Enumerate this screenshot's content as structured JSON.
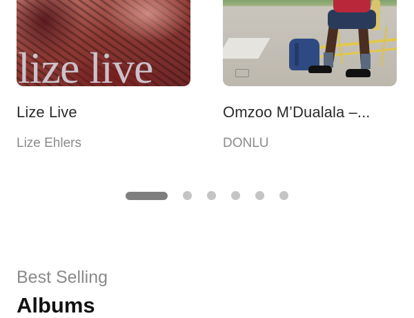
{
  "carousel": {
    "albums": [
      {
        "cover_text": "lize live",
        "title": "Lize Live",
        "artist": "Lize Ehlers"
      },
      {
        "cover_text": "",
        "title": "Omzoo M’Dualala –...",
        "artist": "DONLU"
      }
    ],
    "pager": {
      "count": 6,
      "active_index": 0
    }
  },
  "section": {
    "kicker": "Best Selling",
    "heading": "Albums"
  },
  "colors": {
    "text_primary": "#2b2b2b",
    "text_secondary": "#8a8a8a",
    "pager_active": "#7f7f7f",
    "pager_inactive": "#c4c4c4",
    "heading": "#111111"
  }
}
